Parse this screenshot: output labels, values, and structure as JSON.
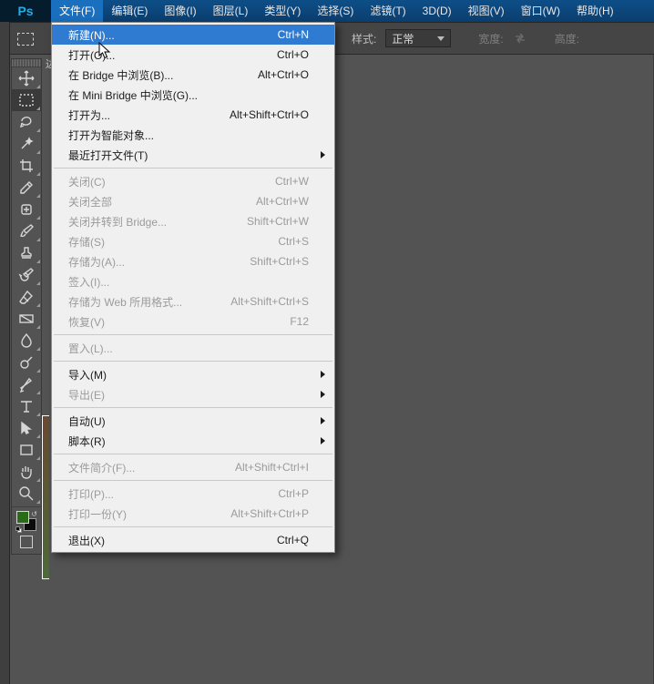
{
  "app": {
    "logo": "Ps"
  },
  "menubar": [
    {
      "label": "文件(F)",
      "open": true
    },
    {
      "label": "编辑(E)"
    },
    {
      "label": "图像(I)"
    },
    {
      "label": "图层(L)"
    },
    {
      "label": "类型(Y)"
    },
    {
      "label": "选择(S)"
    },
    {
      "label": "滤镜(T)"
    },
    {
      "label": "3D(D)"
    },
    {
      "label": "视图(V)"
    },
    {
      "label": "窗口(W)"
    },
    {
      "label": "帮助(H)"
    }
  ],
  "optionsbar": {
    "style_label": "样式:",
    "style_value": "正常",
    "width_label": "宽度:",
    "height_label": "高度:"
  },
  "tools": [
    {
      "name": "move"
    },
    {
      "name": "marquee",
      "active": true
    },
    {
      "name": "lasso"
    },
    {
      "name": "magic-wand"
    },
    {
      "name": "crop"
    },
    {
      "name": "eyedropper"
    },
    {
      "name": "healing"
    },
    {
      "name": "brush"
    },
    {
      "name": "stamp"
    },
    {
      "name": "history-brush"
    },
    {
      "name": "eraser"
    },
    {
      "name": "gradient"
    },
    {
      "name": "blur"
    },
    {
      "name": "dodge"
    },
    {
      "name": "pen"
    },
    {
      "name": "type"
    },
    {
      "name": "path-select"
    },
    {
      "name": "rectangle"
    },
    {
      "name": "hand"
    },
    {
      "name": "zoom"
    }
  ],
  "file_menu": [
    {
      "label": "新建(N)...",
      "shortcut": "Ctrl+N",
      "hl": true
    },
    {
      "label": "打开(O)...",
      "shortcut": "Ctrl+O"
    },
    {
      "label": "在 Bridge 中浏览(B)...",
      "shortcut": "Alt+Ctrl+O"
    },
    {
      "label": "在 Mini Bridge 中浏览(G)..."
    },
    {
      "label": "打开为...",
      "shortcut": "Alt+Shift+Ctrl+O"
    },
    {
      "label": "打开为智能对象..."
    },
    {
      "label": "最近打开文件(T)",
      "sub": true
    },
    {
      "sep": true
    },
    {
      "label": "关闭(C)",
      "shortcut": "Ctrl+W",
      "dis": true
    },
    {
      "label": "关闭全部",
      "shortcut": "Alt+Ctrl+W",
      "dis": true
    },
    {
      "label": "关闭并转到 Bridge...",
      "shortcut": "Shift+Ctrl+W",
      "dis": true
    },
    {
      "label": "存储(S)",
      "shortcut": "Ctrl+S",
      "dis": true
    },
    {
      "label": "存储为(A)...",
      "shortcut": "Shift+Ctrl+S",
      "dis": true
    },
    {
      "label": "签入(I)...",
      "dis": true
    },
    {
      "label": "存储为 Web 所用格式...",
      "shortcut": "Alt+Shift+Ctrl+S",
      "dis": true
    },
    {
      "label": "恢复(V)",
      "shortcut": "F12",
      "dis": true
    },
    {
      "sep": true
    },
    {
      "label": "置入(L)...",
      "dis": true
    },
    {
      "sep": true
    },
    {
      "label": "导入(M)",
      "sub": true
    },
    {
      "label": "导出(E)",
      "sub": true,
      "dis": true
    },
    {
      "sep": true
    },
    {
      "label": "自动(U)",
      "sub": true
    },
    {
      "label": "脚本(R)",
      "sub": true
    },
    {
      "sep": true
    },
    {
      "label": "文件简介(F)...",
      "shortcut": "Alt+Shift+Ctrl+I",
      "dis": true
    },
    {
      "sep": true
    },
    {
      "label": "打印(P)...",
      "shortcut": "Ctrl+P",
      "dis": true
    },
    {
      "label": "打印一份(Y)",
      "shortcut": "Alt+Shift+Ctrl+P",
      "dis": true
    },
    {
      "sep": true
    },
    {
      "label": "退出(X)",
      "shortcut": "Ctrl+Q"
    }
  ]
}
